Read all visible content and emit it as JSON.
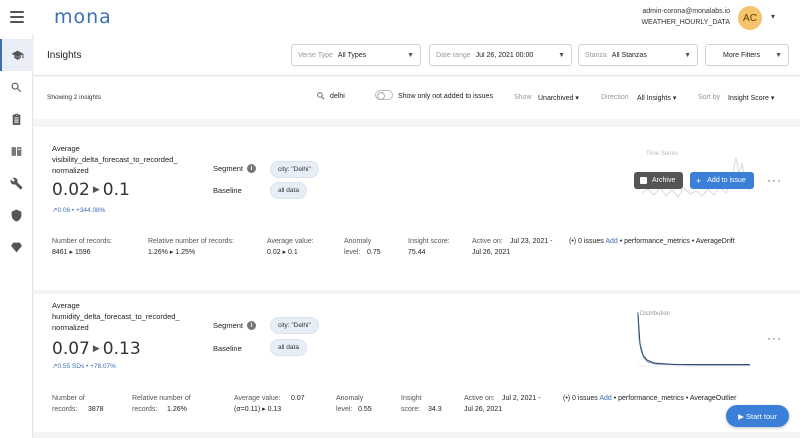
{
  "app": {
    "logo": "mona"
  },
  "user": {
    "email": "admin-corona@monalabs.io",
    "env": "WEATHER_HOURLY_DATA",
    "initials": "AC"
  },
  "page": {
    "title": "Insights"
  },
  "filters": [
    {
      "label": "Verse Type",
      "value": "All Types"
    },
    {
      "label": "Date range",
      "value": "Jul 26, 2021 00:00"
    },
    {
      "label": "Stanza",
      "value": "All Stanzas"
    },
    {
      "label": "",
      "value": "More Filters"
    }
  ],
  "subbar": {
    "showing": "Showing 2 insights",
    "search_value": "delhi",
    "toggle_label": "Show only not added to issues",
    "show_label": "Show",
    "show_value": "Unarchived",
    "direction_label": "Direction",
    "direction_value": "All Insights",
    "sort_label": "Sort by",
    "sort_value": "Insight Score"
  },
  "insights": [
    {
      "title_line1": "Average",
      "title_line2": "visibility_delta_forecast_to_recorded_",
      "title_line3": "normalized",
      "from": "0.02",
      "to": "0.1",
      "trend": "0.06 • +344.08%",
      "segment_label": "Segment",
      "segment_value": "city: \"Delhi\"",
      "baseline_label": "Baseline",
      "baseline_value": "all data",
      "chart_label": "Time Series",
      "archive_label": "Archive",
      "add_issue_label": "Add to issue",
      "records_label": "Number of records:",
      "records_value": "8461 ▸ 1596",
      "rel_label": "Relative number of records:",
      "rel_value": "1.26% ▸ 1.25%",
      "avg_label": "Average value:",
      "avg_value": "0.02 ▸ 0.1",
      "anom_label": "Anomaly",
      "anom_label2": "level:",
      "anom_value": "0.75",
      "score_label": "Insight score:",
      "score_value": "75.44",
      "active_label": "Active on:",
      "active_value1": "Jul 23, 2021 -",
      "active_value2": "Jul 26, 2021",
      "issues_text": "(•) 0 issues",
      "add_text": "Add",
      "tag1": "performance_metrics",
      "tag2": "AverageDrift"
    },
    {
      "title_line1": "Average",
      "title_line2": "humidity_delta_forecast_to_recorded_",
      "title_line3": "normalized",
      "from": "0.07",
      "to": "0.13",
      "trend": "0.55 SDs • +78.07%",
      "segment_label": "Segment",
      "segment_value": "city: \"Delhi\"",
      "baseline_label": "Baseline",
      "baseline_value": "all data",
      "chart_label": "Distribution",
      "records_label": "Number of",
      "records_label2": "records:",
      "records_value": "3878",
      "rel_label": "Relative number of",
      "rel_label2": "records:",
      "rel_value": "1.26%",
      "avg_label": "Average value:",
      "avg_value": "0.07",
      "avg_label2": "(σ=0.11) ▸ 0.13",
      "anom_label": "Anomaly",
      "anom_label2": "level:",
      "anom_value": "0.55",
      "score_label": "Insight",
      "score_label2": "score:",
      "score_value": "34.3",
      "active_label": "Active on:",
      "active_value1": "Jul 2, 2021 -",
      "active_value2": "Jul 26, 2021",
      "issues_text": "(•) 0 issues",
      "add_text": "Add",
      "tag1": "performance_metrics",
      "tag2": "AverageOutlier"
    }
  ],
  "tour": {
    "label": "▶ Start tour"
  },
  "colors": {
    "accent": "#3c6fb5",
    "button": "#3c7fd9",
    "avatar": "#f4c36b"
  }
}
